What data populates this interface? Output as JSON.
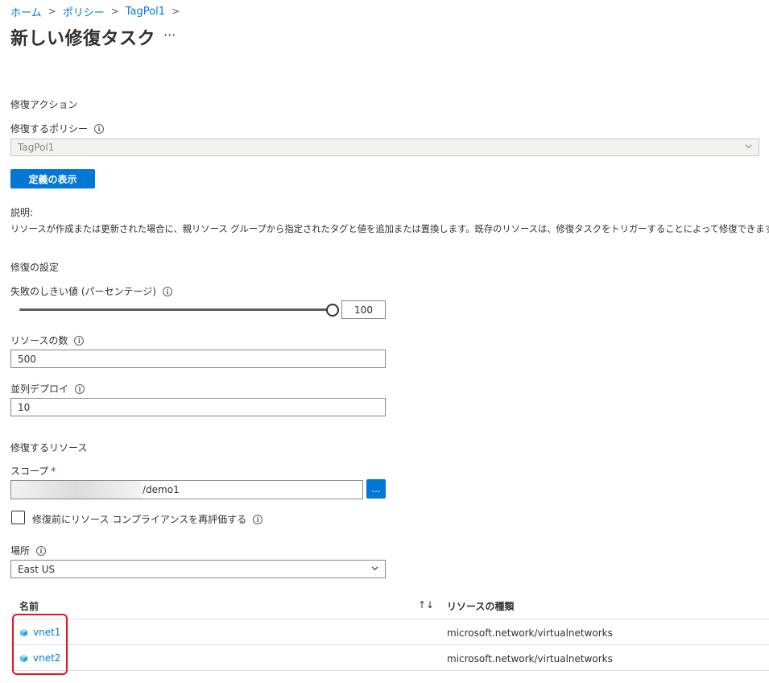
{
  "breadcrumb": {
    "home": "ホーム",
    "policy": "ポリシー",
    "item": "TagPol1",
    "sep": ">"
  },
  "page": {
    "title": "新しい修復タスク",
    "more": "···"
  },
  "remediation_action": {
    "section": "修復アクション",
    "policy_label": "修復するポリシー",
    "policy_value": "TagPol1",
    "view_definition_button": "定義の表示",
    "description_label": "説明:",
    "description_text": "リソースが作成または更新された場合に、親リソース グループから指定されたタグと値を追加または置換します。既存のリソースは、修復タスクをトリガーすることによって修復できます。"
  },
  "settings": {
    "section": "修復の設定",
    "failure_threshold_label": "失敗のしきい値 (パーセンテージ)",
    "failure_threshold_value": "100",
    "failure_threshold_fraction": 1.0,
    "resource_count_label": "リソースの数",
    "resource_count_value": "500",
    "parallel_deployments_label": "並列デプロイ",
    "parallel_deployments_value": "10"
  },
  "resources": {
    "section": "修復するリソース",
    "scope_label": "スコープ",
    "required_mark": "*",
    "scope_value": "/demo1",
    "scope_button": "...",
    "reevaluate_label": "修復前にリソース コンプライアンスを再評価する",
    "reevaluate_checked": false,
    "location_label": "場所",
    "location_value": "East US"
  },
  "table": {
    "col_name": "名前",
    "sort_icon": "↑↓",
    "col_type": "リソースの種類",
    "rows": [
      {
        "name": "vnet1",
        "type": "microsoft.network/virtualnetworks"
      },
      {
        "name": "vnet2",
        "type": "microsoft.network/virtualnetworks"
      }
    ]
  },
  "colors": {
    "accent": "#0078d4",
    "highlight": "#e81123"
  },
  "icons": [
    "info-icon",
    "chevron-down-icon",
    "virtual-network-icon",
    "sort-icon"
  ]
}
